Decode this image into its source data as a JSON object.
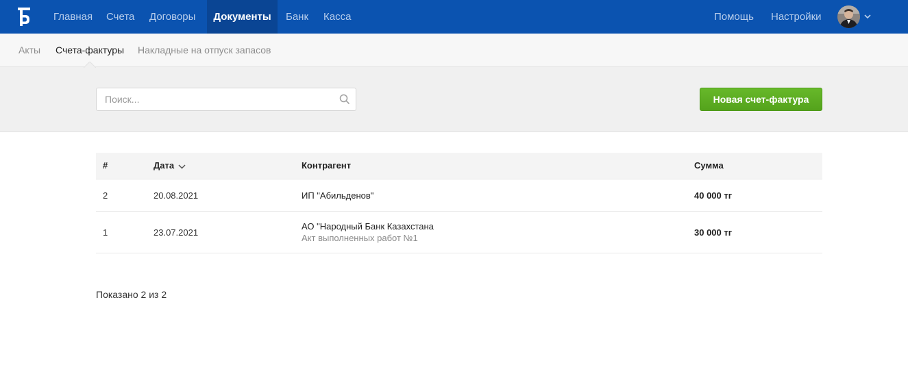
{
  "topbar": {
    "logo": "logo-b-icon",
    "nav": [
      {
        "label": "Главная"
      },
      {
        "label": "Счета"
      },
      {
        "label": "Договоры"
      },
      {
        "label": "Документы",
        "active": true
      },
      {
        "label": "Банк"
      },
      {
        "label": "Касса"
      }
    ],
    "help_label": "Помощь",
    "settings_label": "Настройки",
    "avatar_icon": "user-avatar",
    "chevron_icon": "chevron-down-icon"
  },
  "subnav": {
    "items": [
      {
        "label": "Акты"
      },
      {
        "label": "Счета-фактуры",
        "active": true
      },
      {
        "label": "Накладные на отпуск запасов"
      }
    ]
  },
  "toolbar": {
    "search_placeholder": "Поиск...",
    "search_icon": "search-icon",
    "new_button_label": "Новая счет-фактура"
  },
  "table": {
    "columns": {
      "num": "#",
      "date": "Дата",
      "counterparty": "Контрагент",
      "sum": "Сумма"
    },
    "rows": [
      {
        "num": "2",
        "date": "20.08.2021",
        "counterparty": "ИП \"Абильденов\"",
        "note": "",
        "sum": "40 000 тг"
      },
      {
        "num": "1",
        "date": "23.07.2021",
        "counterparty": "АО \"Народный Банк Казахстана",
        "note": "Акт выполненных работ №1",
        "sum": "30 000 тг"
      }
    ]
  },
  "pager": {
    "text": "Показано 2 из 2"
  },
  "colors": {
    "topbar": "#0b53b0",
    "topbar_active": "#0a4594",
    "button_green": "#5aaa21"
  }
}
